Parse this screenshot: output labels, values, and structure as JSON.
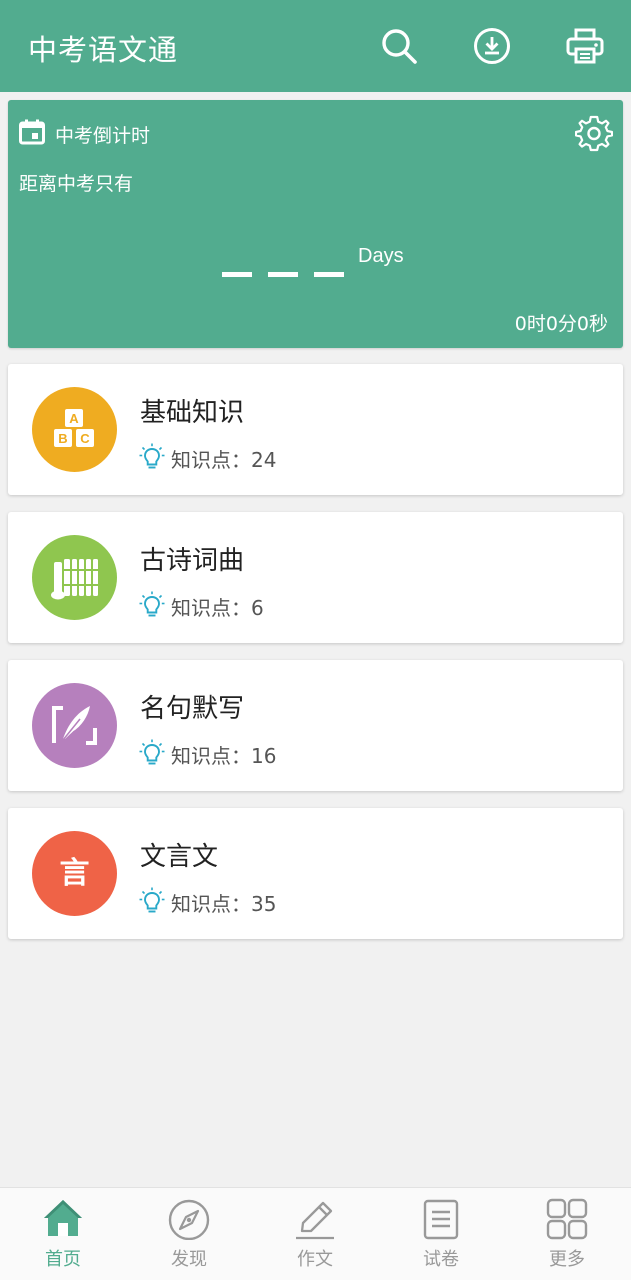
{
  "header": {
    "title": "中考语文通",
    "icons": [
      "search-icon",
      "download-icon",
      "print-icon"
    ]
  },
  "countdown": {
    "title": "中考倒计时",
    "subtitle": "距离中考只有",
    "days_unit": "Days",
    "remaining_time": "0时0分0秒",
    "icons": [
      "calendar-icon",
      "settings-icon"
    ]
  },
  "categories": [
    {
      "title": "基础知识",
      "points": "知识点：24",
      "color": "#efac21",
      "icon": "abc-blocks-icon"
    },
    {
      "title": "古诗词曲",
      "points": "知识点：6",
      "color": "#8fc64f",
      "icon": "bamboo-scroll-icon"
    },
    {
      "title": "名句默写",
      "points": "知识点：16",
      "color": "#b680bd",
      "icon": "quill-icon"
    },
    {
      "title": "文言文",
      "points": "知识点：35",
      "color": "#ef6347",
      "icon": "yan-character-icon"
    }
  ],
  "nav": [
    {
      "label": "首页",
      "icon": "home-icon",
      "active": true
    },
    {
      "label": "发现",
      "icon": "compass-icon",
      "active": false
    },
    {
      "label": "作文",
      "icon": "pencil-icon",
      "active": false
    },
    {
      "label": "试卷",
      "icon": "document-icon",
      "active": false
    },
    {
      "label": "更多",
      "icon": "grid-icon",
      "active": false
    }
  ],
  "colors": {
    "primary": "#52ac8f",
    "background": "#f1f1f1",
    "accent_bulb": "#29a9c9",
    "nav_inactive": "#999999"
  },
  "abc_icon_letters": [
    "A",
    "B",
    "C"
  ],
  "yan_char": "言"
}
